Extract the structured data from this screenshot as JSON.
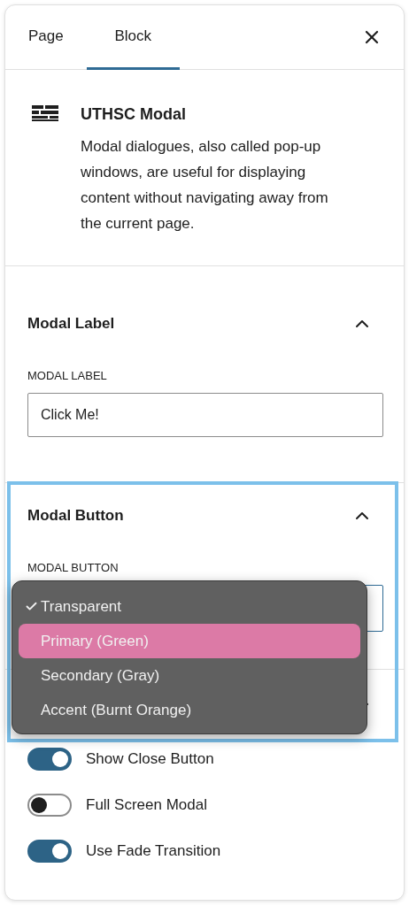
{
  "tabs": [
    {
      "label": "Page",
      "selected": false
    },
    {
      "label": "Block",
      "selected": true
    }
  ],
  "block": {
    "title": "UTHSC Modal",
    "description": "Modal dialogues, also called pop-up windows, are useful for displaying content without navigating away from the current page."
  },
  "modal_label_section": {
    "title": "Modal Label",
    "expanded": true,
    "field_label": "MODAL LABEL",
    "value": "Click Me!"
  },
  "modal_button_section": {
    "title": "Modal Button",
    "expanded": true,
    "field_label": "MODAL BUTTON",
    "options": [
      {
        "label": "Transparent",
        "selected": true,
        "highlighted": false
      },
      {
        "label": "Primary (Green)",
        "selected": false,
        "highlighted": true
      },
      {
        "label": "Secondary (Gray)",
        "selected": false,
        "highlighted": false
      },
      {
        "label": "Accent (Burnt Orange)",
        "selected": false,
        "highlighted": false
      }
    ]
  },
  "options_section": {
    "expanded": true,
    "toggles": [
      {
        "label": "Show Close Button",
        "on": true
      },
      {
        "label": "Full Screen Modal",
        "on": false
      },
      {
        "label": "Use Fade Transition",
        "on": true
      }
    ]
  }
}
